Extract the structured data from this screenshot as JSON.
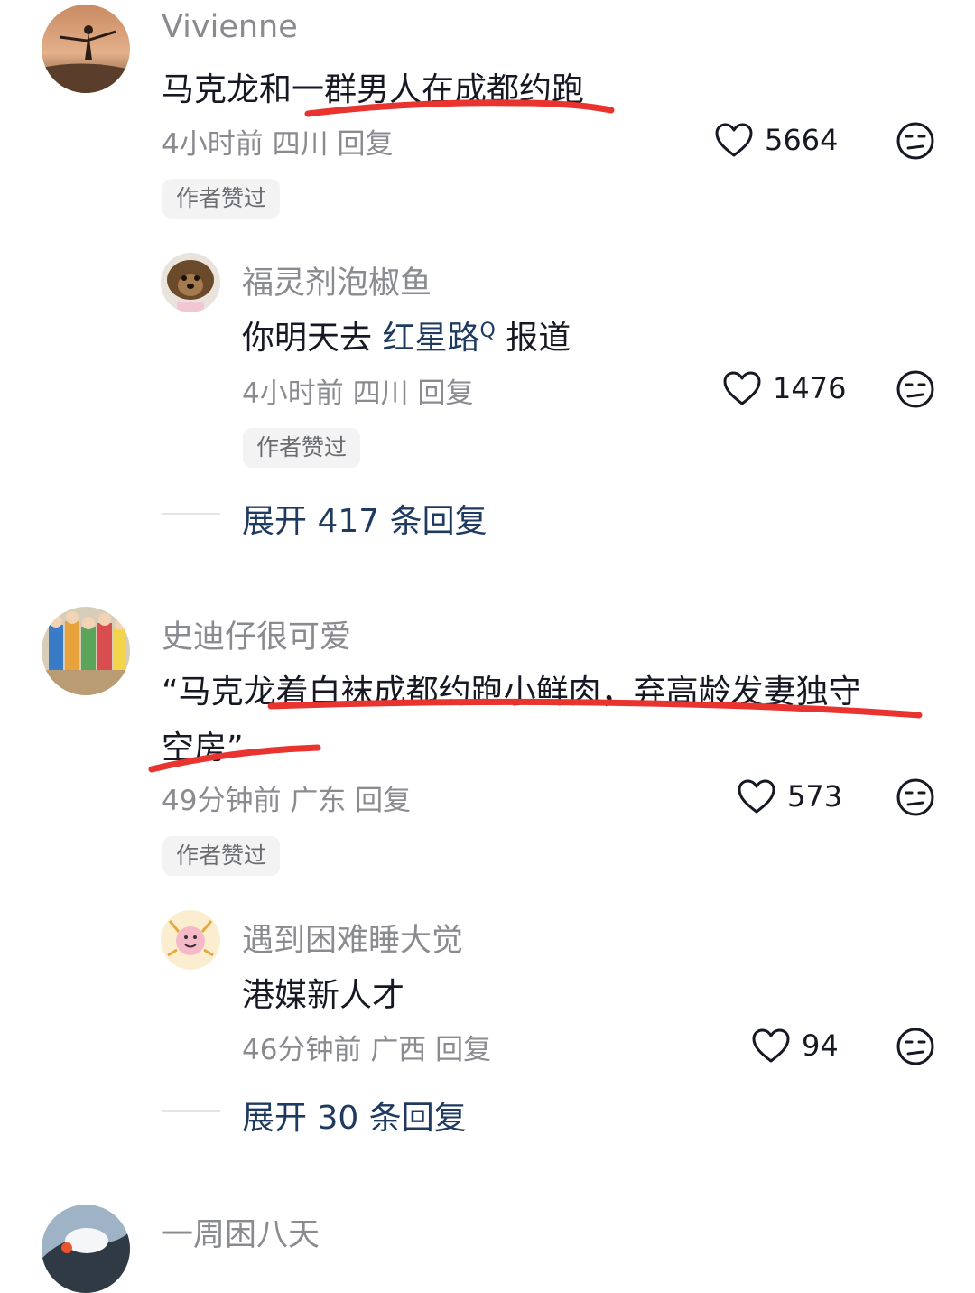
{
  "comments": [
    {
      "username": "Vivienne",
      "text": "马克龙和一群男人在成都约跑",
      "time": "4小时前",
      "location": "四川",
      "reply_label": "回复",
      "likes": "5664",
      "badge": "作者赞过",
      "replies": [
        {
          "username": "福灵剂泡椒鱼",
          "text_before": "你明天去 ",
          "link_text": "红星路",
          "text_after": " 报道",
          "time": "4小时前",
          "location": "四川",
          "reply_label": "回复",
          "likes": "1476",
          "badge": "作者赞过"
        }
      ],
      "expand_label": "展开 417 条回复"
    },
    {
      "username": "史迪仔很可爱",
      "text_line1": "“马克龙着白袜成都约跑小鲜肉，弃高龄发妻独守",
      "text_line2": "空房”",
      "time": "49分钟前",
      "location": "广东",
      "reply_label": "回复",
      "likes": "573",
      "badge": "作者赞过",
      "replies": [
        {
          "username": "遇到困难睡大觉",
          "text": "港媒新人才",
          "time": "46分钟前",
          "location": "广西",
          "reply_label": "回复",
          "likes": "94"
        }
      ],
      "expand_label": "展开 30 条回复"
    },
    {
      "username": "一周困八天"
    }
  ],
  "icons": {
    "like": "heart-outline-icon",
    "dislike": "unhappy-face-icon",
    "search": "search-icon"
  },
  "colors": {
    "underline": "#e8332f",
    "link": "#1f3a5f",
    "muted": "#8a8b91"
  }
}
